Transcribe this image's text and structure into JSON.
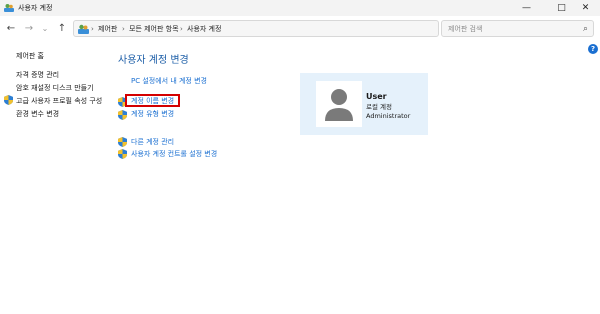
{
  "window": {
    "title": "사용자 계정",
    "minimize_glyph": "—",
    "maximize_glyph": "□",
    "close_glyph": "✕"
  },
  "nav": {
    "back": "←",
    "forward": "→",
    "recent": "⌄",
    "up": "↑"
  },
  "address": {
    "breadcrumbs": [
      "제어판",
      "모든 제어판 항목",
      "사용자 계정"
    ],
    "separator": "›",
    "dropdown": "⌄",
    "refresh": "↻"
  },
  "search": {
    "placeholder": "제어판 검색",
    "icon": "⌕"
  },
  "help": {
    "glyph": "?"
  },
  "sidebar": {
    "home": "제어판 홈",
    "items": [
      {
        "label": "자격 증명 관리",
        "shield": false
      },
      {
        "label": "암호 재설정 디스크 만들기",
        "shield": false
      },
      {
        "label": "고급 사용자 프로필 속성 구성",
        "shield": true
      },
      {
        "label": "환경 변수 변경",
        "shield": false
      }
    ]
  },
  "main": {
    "heading": "사용자 계정 변경",
    "links": [
      {
        "label": "PC 설정에서 내 계정 변경",
        "shield": false
      },
      {
        "label": "계정 이름 변경",
        "shield": true,
        "highlighted": true
      },
      {
        "label": "계정 유형 변경",
        "shield": true
      }
    ],
    "more_links": [
      {
        "label": "다른 계정 관리",
        "shield": true
      },
      {
        "label": "사용자 계정 컨트롤 설정 변경",
        "shield": true
      }
    ]
  },
  "user": {
    "name": "User",
    "type": "로컬 계정",
    "role": "Administrator"
  },
  "colors": {
    "link": "#1a6fd1",
    "heading": "#1e5fa8",
    "highlight_border": "#d40000",
    "card_background": "#e5f1fb"
  }
}
